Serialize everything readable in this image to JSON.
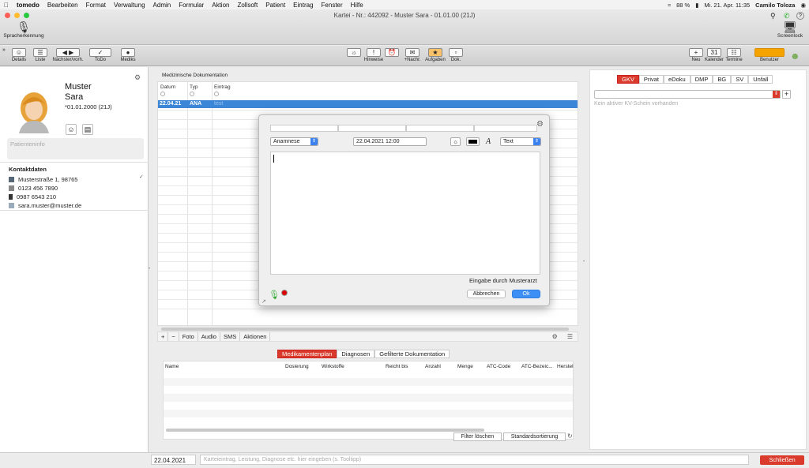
{
  "menubar": {
    "items": [
      "tomedo",
      "Bearbeiten",
      "Format",
      "Verwaltung",
      "Admin",
      "Formular",
      "Aktion",
      "Zollsoft",
      "Patient",
      "Eintrag",
      "Fenster",
      "Hilfe"
    ],
    "battery": "88 %",
    "datetime": "Mi. 21. Apr.  11:35",
    "user": "Camilo Toloza"
  },
  "window": {
    "title": "Kartei - Nr.: 442092 - Muster Sara - 01.01.00 (21J)",
    "sprach_label": "Spracherkennung",
    "screenlock_label": "Screenlock"
  },
  "toolbar": {
    "left": [
      "Details",
      "Liste",
      "Nächster/vorh.",
      "ToDo",
      "Mediks"
    ],
    "center": [
      "Hinweise",
      "+Nachr.",
      "Aufgaben",
      "Dok."
    ],
    "right": [
      "Neu",
      "Kalender",
      "Termine",
      "Benutzer"
    ]
  },
  "patient": {
    "lastname": "Muster",
    "firstname": "Sara",
    "dob": "*01.01.2000 (21J)",
    "info_placeholder": "Patienteninfo",
    "contact_header": "Kontaktdaten",
    "address": "Musterstraße 1, 98765",
    "phone": "0123 456 7890",
    "mobile": "0987 6543 210",
    "email": "sara.muster@muster.de"
  },
  "doc": {
    "title": "Medizinische Dokumentation",
    "col_date": "Datum",
    "col_type": "Typ",
    "col_entry": "Eintrag",
    "row_date": "22.04.21",
    "row_type": "ANA",
    "row_entry": "test"
  },
  "dialog": {
    "type_select": "Anamnese",
    "datetime": "22.04.2021   12:00",
    "format_select": "Text",
    "entered_by": "Eingabe durch Musterarzt",
    "cancel": "Abbrechen",
    "ok": "Ok"
  },
  "docfooter": [
    "+",
    "−",
    "Foto",
    "Audio",
    "SMS",
    "Aktionen"
  ],
  "medtabs": [
    "Medikamentenplan",
    "Diagnosen",
    "Gefilterte Dokumentation"
  ],
  "medcols": [
    "Name",
    "Dosierung",
    "Wirkstoffe",
    "Reicht bis",
    "Anzahl",
    "Menge",
    "ATC-Code",
    "ATC-Bezeic...",
    "Herstel"
  ],
  "medbuttons": {
    "filter": "Filter löschen",
    "sort": "Standardsortierung"
  },
  "right": {
    "tabs": [
      "GKV",
      "Privat",
      "eDoku",
      "DMP",
      "BG",
      "SV",
      "Unfall"
    ],
    "no_kv": "Kein aktiver KV-Schein vorhanden"
  },
  "bottom": {
    "date": "22.04.2021",
    "entry_placeholder": "Karteieintrag, Leistung, Diagnose etc. hier eingeben (s. Tooltipp)",
    "close": "Schließen"
  },
  "colors": {
    "accent": "#3b86d6",
    "red": "#d93a2b",
    "benutzer": "#f4a300"
  }
}
